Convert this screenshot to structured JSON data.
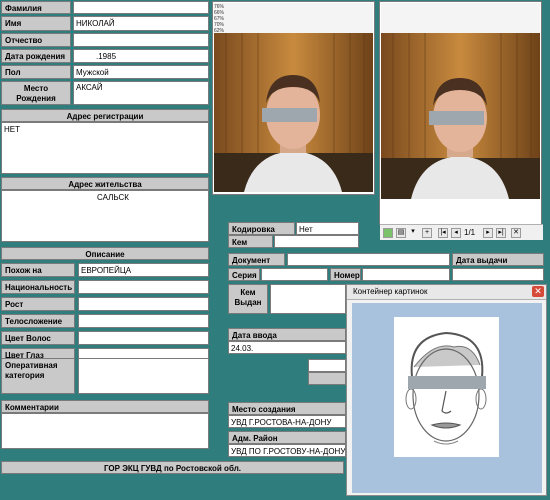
{
  "person": {
    "surname_label": "Фамилия",
    "surname": "",
    "name_label": "Имя",
    "name": "НИКОЛАЙ",
    "patronymic_label": "Отчество",
    "patronymic": "",
    "dob_label": "Дата рождения",
    "dob": ".1985",
    "sex_label": "Пол",
    "sex": "Мужской",
    "birthplace_label_1": "Место",
    "birthplace_label_2": "Рождения",
    "birthplace": "АКСАЙ"
  },
  "registration": {
    "header": "Адрес регистрации",
    "value": "НЕТ"
  },
  "residence": {
    "header": "Адрес жительства",
    "value": "САЛЬСК"
  },
  "description": {
    "header": "Описание",
    "rows": [
      {
        "label": "Похож на",
        "value": "ЕВРОПЕЙЦА"
      },
      {
        "label": "Национальность",
        "value": ""
      },
      {
        "label": "Рост",
        "value": ""
      },
      {
        "label": "Телосложение",
        "value": ""
      },
      {
        "label": "Цвет Волос",
        "value": ""
      },
      {
        "label": "Цвет Глаз",
        "value": ""
      }
    ],
    "op_label_1": "Оперативная",
    "op_label_2": "категория",
    "op_value": ""
  },
  "comments": {
    "header": "Комментарии",
    "value": ""
  },
  "footer": {
    "org": "ГОР ЭКЦ ГУВД по Ростовской обл."
  },
  "photo": {
    "overlay_lines": [
      "76%",
      "66%",
      "67%",
      "70%",
      "62%"
    ]
  },
  "viewer_toolbar": {
    "page": "1/1"
  },
  "encoding": {
    "code_label": "Кодировка",
    "code_value": "Нет",
    "by_label": "Кем",
    "by_value": ""
  },
  "document": {
    "doc_label": "Документ",
    "doc_value": "",
    "issue_date_label": "Дата выдачи",
    "issue_date": "",
    "series_label": "Серия",
    "series": "",
    "number_label": "Номер",
    "number": "",
    "issued_by_label_1": "Кем",
    "issued_by_label_2": "Выдан",
    "issued_by": ""
  },
  "entry": {
    "date_label": "Дата ввода",
    "date": "24.03."
  },
  "creation": {
    "place_label": "Место создания",
    "place": "УВД Г.РОСТОВА-НА-ДОНУ",
    "district_label": "Адм. Район",
    "district": "УВД ПО Г.РОСТОВУ-НА-ДОНУ"
  },
  "popup": {
    "title": "Контейнер картинок"
  },
  "colors": {
    "background": "#2f7d7d",
    "label_bg": "#c9c9c9",
    "popup_bg": "#a8c2dd"
  }
}
